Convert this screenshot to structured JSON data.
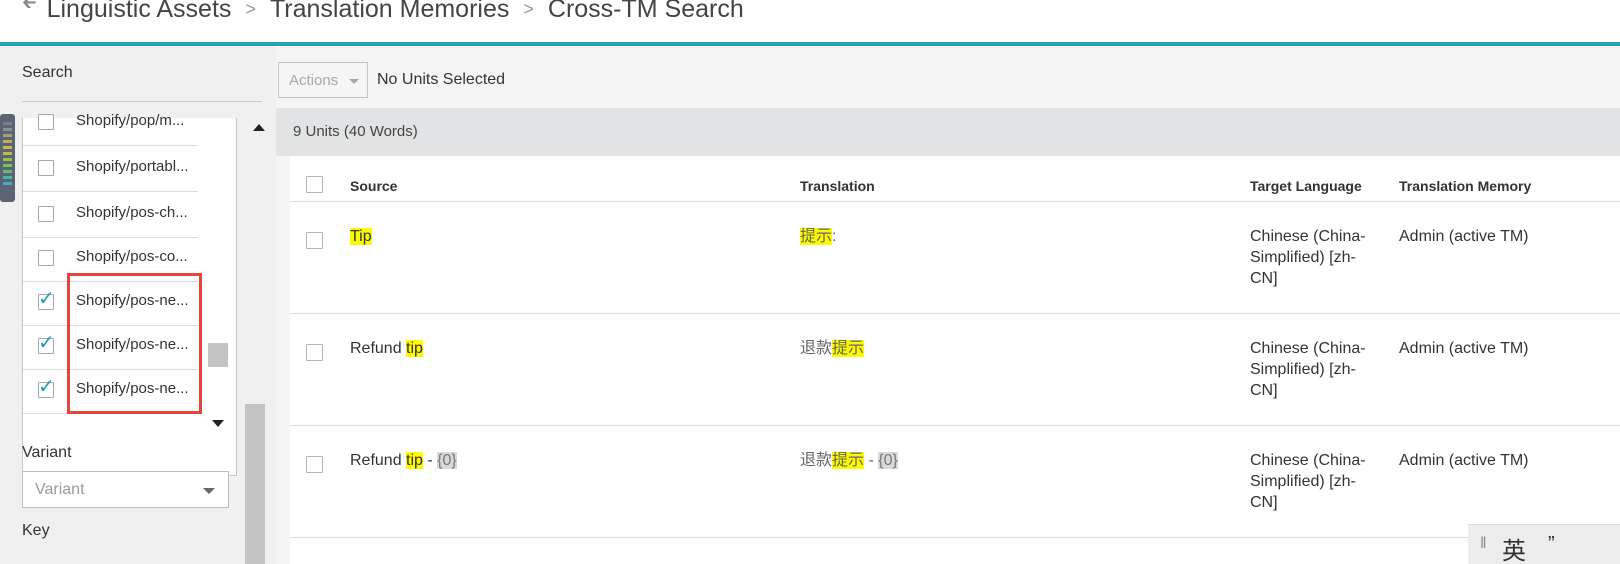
{
  "breadcrumb": {
    "back_icon": "arrow-left",
    "items": [
      "Linguistic Assets",
      "Translation Memories",
      "Cross-TM Search"
    ],
    "separator": ">"
  },
  "sidebar": {
    "search_label": "Search",
    "list_items": [
      {
        "label": "Shopify/pop/m...",
        "checked": false
      },
      {
        "label": "Shopify/portabl...",
        "checked": false
      },
      {
        "label": "Shopify/pos-ch...",
        "checked": false
      },
      {
        "label": "Shopify/pos-co...",
        "checked": false
      },
      {
        "label": "Shopify/pos-ne...",
        "checked": true
      },
      {
        "label": "Shopify/pos-ne...",
        "checked": true
      },
      {
        "label": "Shopify/pos-ne...",
        "checked": true
      }
    ],
    "variant_label": "Variant",
    "variant_placeholder": "Variant",
    "key_label": "Key"
  },
  "toolbar": {
    "actions_label": "Actions",
    "selection_status": "No Units Selected"
  },
  "results": {
    "summary": "9 Units (40 Words)",
    "columns": {
      "source": "Source",
      "translation": "Translation",
      "target_language": "Target Language",
      "translation_memory": "Translation Memory"
    },
    "rows": [
      {
        "source_pre": "",
        "source_hl": "Tip",
        "source_post": "",
        "source_tag": "",
        "trans_pre": "",
        "trans_hl": "提示",
        "trans_post": ":",
        "trans_tag": "",
        "target_language": "Chinese (China-Simplified) [zh-CN]",
        "translation_memory": "Admin (active TM)"
      },
      {
        "source_pre": "Refund ",
        "source_hl": "tip",
        "source_post": "",
        "source_tag": "",
        "trans_pre": "退款",
        "trans_hl": "提示",
        "trans_post": "",
        "trans_tag": "",
        "target_language": "Chinese (China-Simplified) [zh-CN]",
        "translation_memory": "Admin (active TM)"
      },
      {
        "source_pre": "Refund ",
        "source_hl": "tip",
        "source_post": " - ",
        "source_tag": "{0}",
        "trans_pre": "退款",
        "trans_hl": "提示",
        "trans_post": " - ",
        "trans_tag": "{0}",
        "target_language": "Chinese (China-Simplified) [zh-CN]",
        "translation_memory": "Admin (active TM)"
      }
    ]
  },
  "colors": {
    "accent_teal": "#27a3b0",
    "highlight_yellow": "#fcfb00",
    "annotation_red": "#e5453a",
    "check_blue": "#1e9bb8"
  }
}
